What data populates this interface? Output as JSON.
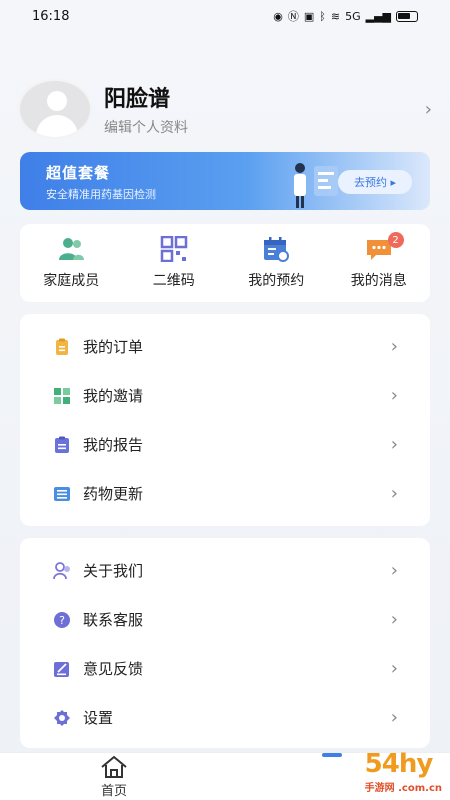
{
  "status": {
    "time": "16:18",
    "net": "5G"
  },
  "profile": {
    "name": "阳脸谱",
    "edit_label": "编辑个人资料"
  },
  "banner": {
    "title": "超值套餐",
    "subtitle": "安全精准用药基因检测",
    "button": "去预约 ▸"
  },
  "quick": {
    "items": [
      {
        "label": "家庭成员",
        "icon": "family-icon",
        "color": "#4cae8c"
      },
      {
        "label": "二维码",
        "icon": "qrcode-icon",
        "color": "#6e6fd6"
      },
      {
        "label": "我的预约",
        "icon": "calendar-icon",
        "color": "#4a7fd8"
      },
      {
        "label": "我的消息",
        "icon": "message-icon",
        "color": "#f0913a",
        "badge": "2"
      }
    ]
  },
  "menu1": {
    "items": [
      {
        "label": "我的订单",
        "icon": "order-icon",
        "color": "#f2b443"
      },
      {
        "label": "我的邀请",
        "icon": "invite-icon",
        "color": "#44b079"
      },
      {
        "label": "我的报告",
        "icon": "report-icon",
        "color": "#6a72d9"
      },
      {
        "label": "药物更新",
        "icon": "medicine-icon",
        "color": "#4a8ee0"
      }
    ]
  },
  "menu2": {
    "items": [
      {
        "label": "关于我们",
        "icon": "about-icon",
        "color": "#7b76d6"
      },
      {
        "label": "联系客服",
        "icon": "service-icon",
        "color": "#6e6fd6"
      },
      {
        "label": "意见反馈",
        "icon": "feedback-icon",
        "color": "#6e6fd6"
      },
      {
        "label": "设置",
        "icon": "settings-icon",
        "color": "#6e6fd6"
      }
    ]
  },
  "nav": {
    "home_label": "首页"
  },
  "watermark": {
    "text": "54hy",
    "sub": "手游网 .com.cn"
  }
}
